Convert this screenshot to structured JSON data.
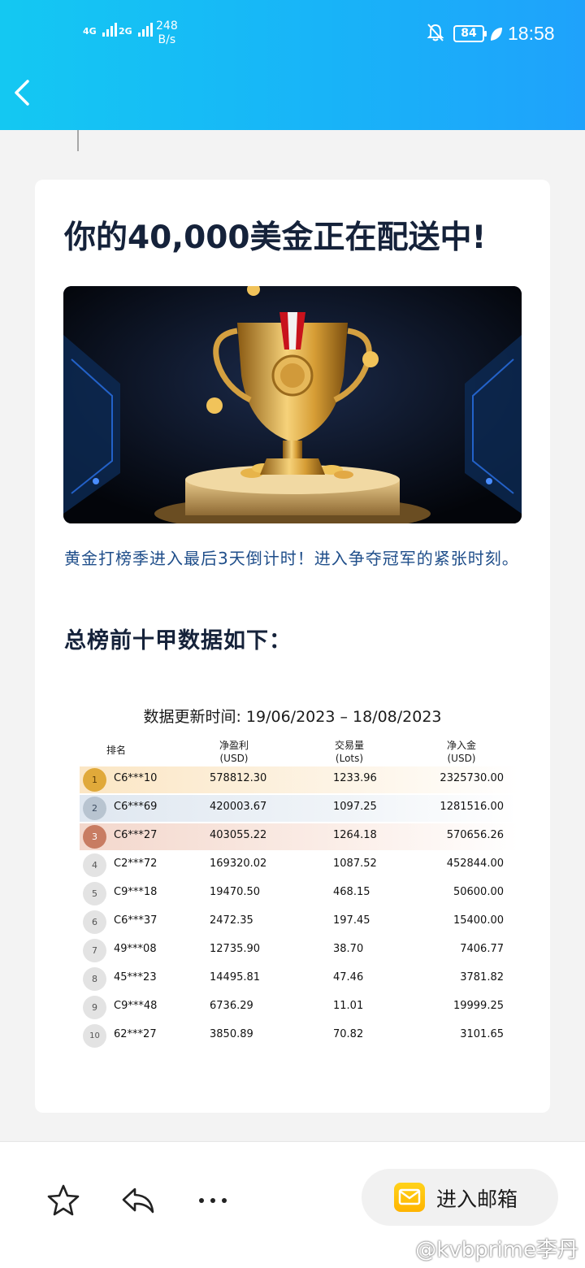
{
  "status_bar": {
    "sim1_label": "4G",
    "sim2_label": "2G",
    "net_speed_value": "248",
    "net_speed_unit": "B/s",
    "battery": "84",
    "time": "18:58"
  },
  "header": {
    "back_icon": "chevron-left-icon"
  },
  "email": {
    "headline": "你的40,000美金正在配送中!",
    "intro": "黄金打榜季进入最后3天倒计时！进入争夺冠军的紧张时刻。",
    "subhead": "总榜前十甲数据如下：",
    "updated": "数据更新时间: 19/06/2023 – 18/08/2023",
    "columns": {
      "rank": "排名",
      "profit": "净盈利",
      "profit_unit": "(USD)",
      "lots": "交易量",
      "lots_unit": "(Lots)",
      "deposit": "净入金",
      "deposit_unit": "(USD)"
    },
    "rows": [
      {
        "rank": "1",
        "name": "C6***10",
        "profit": "578812.30",
        "lots": "1233.96",
        "deposit": "2325730.00"
      },
      {
        "rank": "2",
        "name": "C6***69",
        "profit": "420003.67",
        "lots": "1097.25",
        "deposit": "1281516.00"
      },
      {
        "rank": "3",
        "name": "C6***27",
        "profit": "403055.22",
        "lots": "1264.18",
        "deposit": "570656.26"
      },
      {
        "rank": "4",
        "name": "C2***72",
        "profit": "169320.02",
        "lots": "1087.52",
        "deposit": "452844.00"
      },
      {
        "rank": "5",
        "name": "C9***18",
        "profit": "19470.50",
        "lots": "468.15",
        "deposit": "50600.00"
      },
      {
        "rank": "6",
        "name": "C6***37",
        "profit": "2472.35",
        "lots": "197.45",
        "deposit": "15400.00"
      },
      {
        "rank": "7",
        "name": "49***08",
        "profit": "12735.90",
        "lots": "38.70",
        "deposit": "7406.77"
      },
      {
        "rank": "8",
        "name": "45***23",
        "profit": "14495.81",
        "lots": "47.46",
        "deposit": "3781.82"
      },
      {
        "rank": "9",
        "name": "C9***48",
        "profit": "6736.29",
        "lots": "11.01",
        "deposit": "19999.25"
      },
      {
        "rank": "10",
        "name": "62***27",
        "profit": "3850.89",
        "lots": "70.82",
        "deposit": "3101.65"
      }
    ]
  },
  "bottom_bar": {
    "star_icon": "star-icon",
    "reply_icon": "reply-icon",
    "more_icon": "more-icon",
    "mail_button_label": "进入邮箱"
  },
  "watermark": "@kvbprime李丹",
  "colors": {
    "header_start": "#14c8f2",
    "header_end": "#1fa2fb",
    "gold": "#e0a93a",
    "silver": "#b8c4d0",
    "bronze": "#c87c62",
    "text_dark": "#15223a",
    "text_blue": "#1f4e8a"
  }
}
